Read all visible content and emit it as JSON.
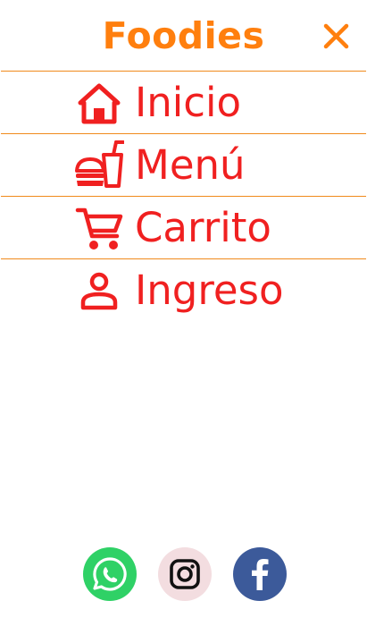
{
  "header": {
    "brand": "Foodies"
  },
  "nav": {
    "items": [
      {
        "label": "Inicio",
        "icon": "home-icon"
      },
      {
        "label": "Menú",
        "icon": "burger-drink-icon"
      },
      {
        "label": "Carrito",
        "icon": "cart-icon"
      },
      {
        "label": "Ingreso",
        "icon": "person-icon"
      }
    ]
  },
  "social": {
    "items": [
      {
        "name": "whatsapp",
        "icon": "whatsapp-icon"
      },
      {
        "name": "instagram",
        "icon": "instagram-icon"
      },
      {
        "name": "facebook",
        "icon": "facebook-icon"
      }
    ]
  },
  "colors": {
    "brand": "#ff7f0e",
    "nav_text": "#f02020",
    "divider": "#f08a1c",
    "whatsapp": "#2fd166",
    "instagram": "#f3dde0",
    "facebook": "#3c5a9a"
  }
}
